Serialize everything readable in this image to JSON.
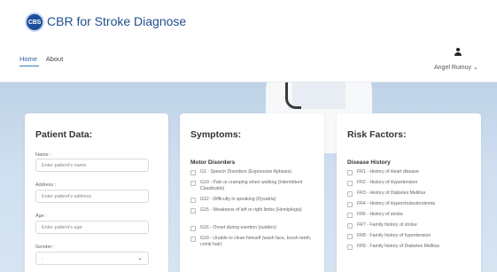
{
  "header": {
    "logo_text": "CBS",
    "title": "CBR for Stroke Diagnose",
    "user_name": "Angel Rumuy"
  },
  "nav": {
    "home": "Home",
    "about": "About"
  },
  "patient": {
    "heading": "Patient Data:",
    "name_label": "Name :",
    "name_placeholder": "Enter patient's name",
    "address_label": "Address :",
    "address_placeholder": "Enter patient's address",
    "age_label": "Age :",
    "age_placeholder": "Enter patient's age",
    "gender_label": "Gender :",
    "gender_value": "-"
  },
  "symptoms": {
    "heading": "Symptoms:",
    "section": "Motor Disorders",
    "items": [
      "G1 - Speech Disorders (Expressive Aphasia)",
      "G10 - Pain or cramping when walking (Intermittent Claudicatio)",
      "G12 - Difficulty in speaking (Dysatria)",
      "G15 - Weakness of left or right limbs (Hemiplegia)",
      "G16 - Onset during exertion (sudden)",
      "G19 - Unable to clean himself (wash face, brush teeth, comb hair)"
    ]
  },
  "risk": {
    "heading": "Risk Factors:",
    "section": "Disease History",
    "items": [
      "FR1 - History of Heart disease",
      "FR2 - History of Hypertension",
      "FR3 - History of Diabetes Mellitus",
      "FR4 - History of Hypercholesterolemia",
      "FR6 - History of stroke",
      "FR7 - Family history of stroke",
      "FR8 - Family history of hypertension",
      "FR9 - Family history of Diabetes Mellitus"
    ]
  },
  "colors": {
    "brand": "#1f4e8c",
    "hero_bg": "#cfdff0"
  }
}
